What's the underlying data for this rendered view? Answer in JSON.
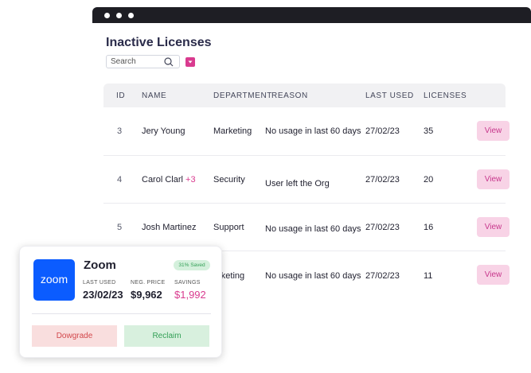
{
  "page": {
    "title": "Inactive Licenses",
    "search_placeholder": "Search"
  },
  "table": {
    "headers": {
      "id": "ID",
      "name": "NAME",
      "department": "DEPARTMENT",
      "reason": "REASON",
      "last_used": "LAST USED",
      "licenses": "LICENSES"
    },
    "rows": [
      {
        "id": "3",
        "name": "Jery Young",
        "extra": "",
        "department": "Marketing",
        "reason": "No usage in last 60 days",
        "last_used": "27/02/23",
        "licenses": "35",
        "action": "View"
      },
      {
        "id": "4",
        "name": "Carol Clarl",
        "extra": "+3",
        "department": "Security",
        "reason": "User left the Org",
        "last_used": "27/02/23",
        "licenses": "20",
        "action": "View"
      },
      {
        "id": "5",
        "name": "Josh Martinez",
        "extra": "",
        "department": "Support",
        "reason": "No usage in last 60 days",
        "last_used": "27/02/23",
        "licenses": "16",
        "action": "View"
      },
      {
        "id": "",
        "name": "",
        "extra": "",
        "department": "arketing",
        "reason": "No usage in last 60 days",
        "last_used": "27/02/23",
        "licenses": "11",
        "action": "View"
      }
    ]
  },
  "card": {
    "logo_text": "zoom",
    "app_name": "Zoom",
    "saved_badge": "31% Saved",
    "last_used_label": "LAST USED",
    "last_used_value": "23/02/23",
    "price_label": "NEG. PRICE",
    "price_value": "$9,962",
    "savings_label": "SAVINGS",
    "savings_value": "$1,992",
    "downgrade_label": "Dowgrade",
    "reclaim_label": "Reclaim"
  },
  "colors": {
    "accent_pink": "#d93b8f",
    "zoom_blue": "#0b5cff",
    "success_green": "#34a057",
    "danger_red": "#d2474b"
  },
  "icons": {
    "search": "search-icon",
    "filter": "chevron-down-icon"
  }
}
